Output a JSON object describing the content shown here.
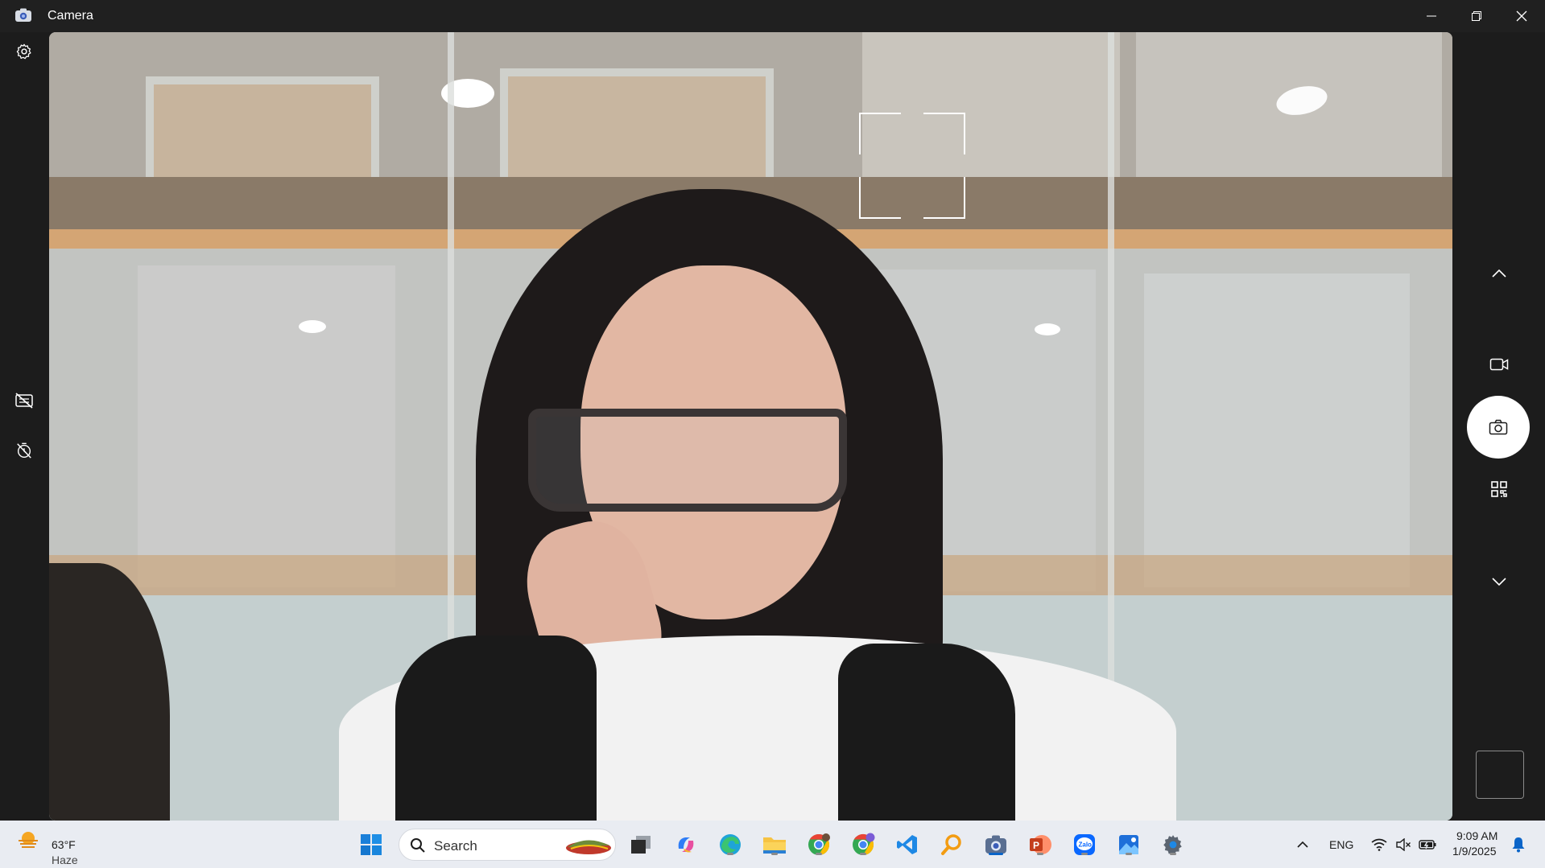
{
  "window": {
    "title": "Camera"
  },
  "taskbar": {
    "weather": {
      "temp": "63°F",
      "condition": "Haze"
    },
    "search": {
      "placeholder": "Search"
    },
    "tray": {
      "language": "ENG",
      "time": "9:09 AM",
      "date": "1/9/2025"
    }
  },
  "icons": {
    "app": "camera-app-icon",
    "settings": "gear-icon",
    "hdr": "hdr-off-icon",
    "timer": "timer-off-icon",
    "up": "chevron-up-icon",
    "video": "video-icon",
    "photo": "camera-icon",
    "qr": "qr-code-icon",
    "down": "chevron-down-icon"
  },
  "colors": {
    "titlebar": "#202020",
    "rail": "#1c1c1c",
    "taskbar": "#e9ecf2",
    "accent": "#0a64c8"
  }
}
